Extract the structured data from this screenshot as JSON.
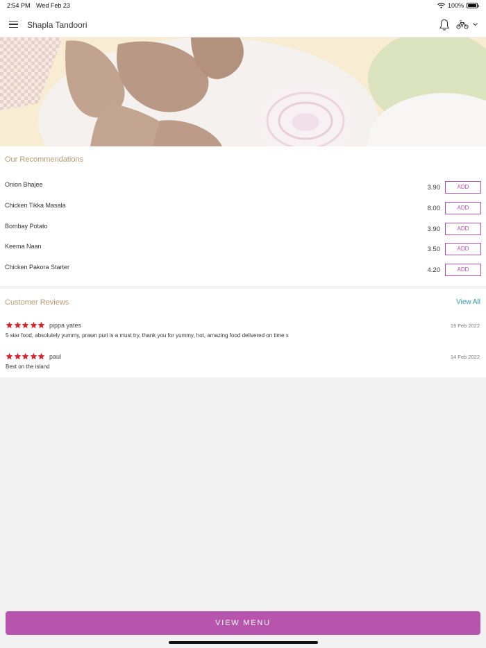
{
  "status_bar": {
    "time": "2:54 PM",
    "date": "Wed Feb 23",
    "battery": "100%"
  },
  "header": {
    "title": "Shapla Tandoori",
    "icons": [
      "menu-icon",
      "bell-icon",
      "delivery-bike-icon",
      "chevron-down-icon"
    ]
  },
  "recommendations": {
    "title": "Our Recommendations",
    "items": [
      {
        "name": "Onion Bhajee",
        "price": "3.90",
        "button": "ADD"
      },
      {
        "name": "Chicken Tikka Masala",
        "price": "8.00",
        "button": "ADD"
      },
      {
        "name": "Bombay Potato",
        "price": "3.90",
        "button": "ADD"
      },
      {
        "name": "Keema Naan",
        "price": "3.50",
        "button": "ADD"
      },
      {
        "name": "Chicken Pakora Starter",
        "price": "4.20",
        "button": "ADD"
      }
    ]
  },
  "reviews": {
    "title": "Customer Reviews",
    "view_all": "View All",
    "items": [
      {
        "name": "pippa yates",
        "date": "19 Feb 2022",
        "rating": 5,
        "text": "5 star food, absolutely yummy, prawn puri is a must try, thank you for yummy, hot, amazing food delivered on time x"
      },
      {
        "name": "paul",
        "date": "14 Feb 2022",
        "rating": 5,
        "text": "Best on the island"
      }
    ]
  },
  "footer": {
    "view_menu": "VIEW MENU"
  },
  "colors": {
    "accent": "#b654ae",
    "section_title": "#b79a72",
    "link": "#2a9aad",
    "star": "#d9232d"
  }
}
